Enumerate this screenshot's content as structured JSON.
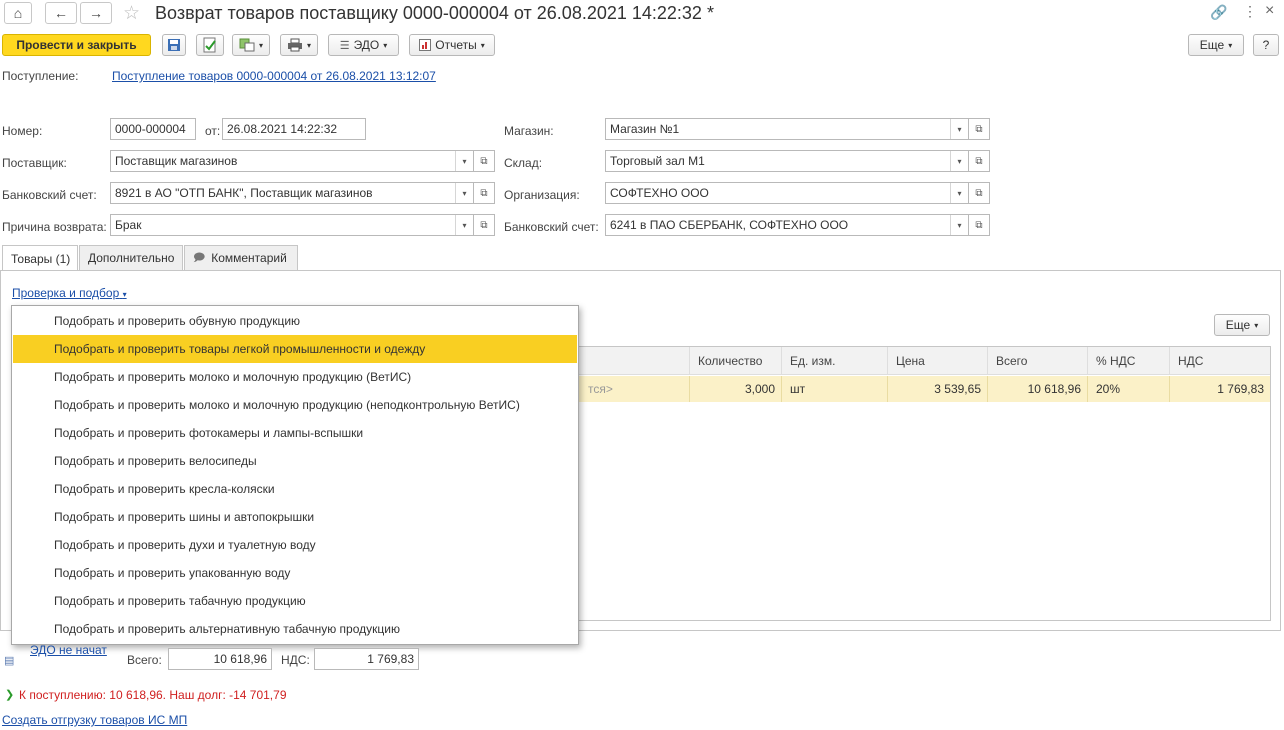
{
  "window": {
    "title": "Возврат товаров поставщику 0000-000004 от 26.08.2021 14:22:32 *"
  },
  "toolbar": {
    "post_close": "Провести и закрыть",
    "edo": "ЭДО",
    "reports": "Отчеты",
    "more": "Еще",
    "help": "?"
  },
  "receipt": {
    "label": "Поступление:",
    "link": "Поступление товаров 0000-000004 от 26.08.2021 13:12:07"
  },
  "form": {
    "number_label": "Номер:",
    "number": "0000-000004",
    "date_label": "от:",
    "date": "26.08.2021 14:22:32",
    "supplier_label": "Поставщик:",
    "supplier": "Поставщик магазинов",
    "bank_label": "Банковский счет:",
    "bank": "8921 в АО \"ОТП БАНК\", Поставщик магазинов",
    "reason_label": "Причина возврата:",
    "reason": "Брак",
    "store_label": "Магазин:",
    "store": "Магазин №1",
    "warehouse_label": "Склад:",
    "warehouse": "Торговый зал М1",
    "org_label": "Организация:",
    "org": "СОФТЕХНО ООО",
    "org_bank_label": "Банковский счет:",
    "org_bank": "6241 в ПАО СБЕРБАНК, СОФТЕХНО ООО"
  },
  "tabs": [
    {
      "label": "Товары (1)"
    },
    {
      "label": "Дополнительно"
    },
    {
      "label": "Комментарий"
    }
  ],
  "goods": {
    "check_link": "Проверка и подбор",
    "more": "Еще",
    "columns": [
      "Количество",
      "Ед. изм.",
      "Цена",
      "Всего",
      "% НДС",
      "НДС"
    ],
    "row": {
      "hidden_text": "тся>",
      "qty": "3,000",
      "unit": "шт",
      "price": "3 539,65",
      "total": "10 618,96",
      "vat_rate": "20%",
      "vat": "1 769,83"
    }
  },
  "menu": {
    "items": [
      "Подобрать и проверить обувную продукцию",
      "Подобрать и проверить товары легкой промышленности и одежду",
      "Подобрать и проверить молоко и молочную продукцию (ВетИС)",
      "Подобрать и проверить молоко и молочную продукцию (неподконтрольную ВетИС)",
      "Подобрать и проверить фотокамеры и лампы-вспышки",
      "Подобрать и проверить велосипеды",
      "Подобрать и проверить кресла-коляски",
      "Подобрать и проверить шины и автопокрышки",
      "Подобрать и проверить духи и туалетную воду",
      "Подобрать и проверить упакованную воду",
      "Подобрать и проверить табачную продукцию",
      "Подобрать и проверить альтернативную табачную продукцию"
    ],
    "selected_index": 1
  },
  "footer": {
    "edo_status": "ЭДО не начат",
    "total_label": "Всего:",
    "total": "10 618,96",
    "vat_label": "НДС:",
    "vat": "1 769,83",
    "due": "К поступлению: 10 618,96. Наш долг: -14 701,79",
    "create_link": "Создать отгрузку товаров ИС МП"
  },
  "colors": {
    "accent": "#ffd81f",
    "selection": "#f9cf22",
    "link": "#1b4fa8",
    "warning": "#d02020"
  }
}
